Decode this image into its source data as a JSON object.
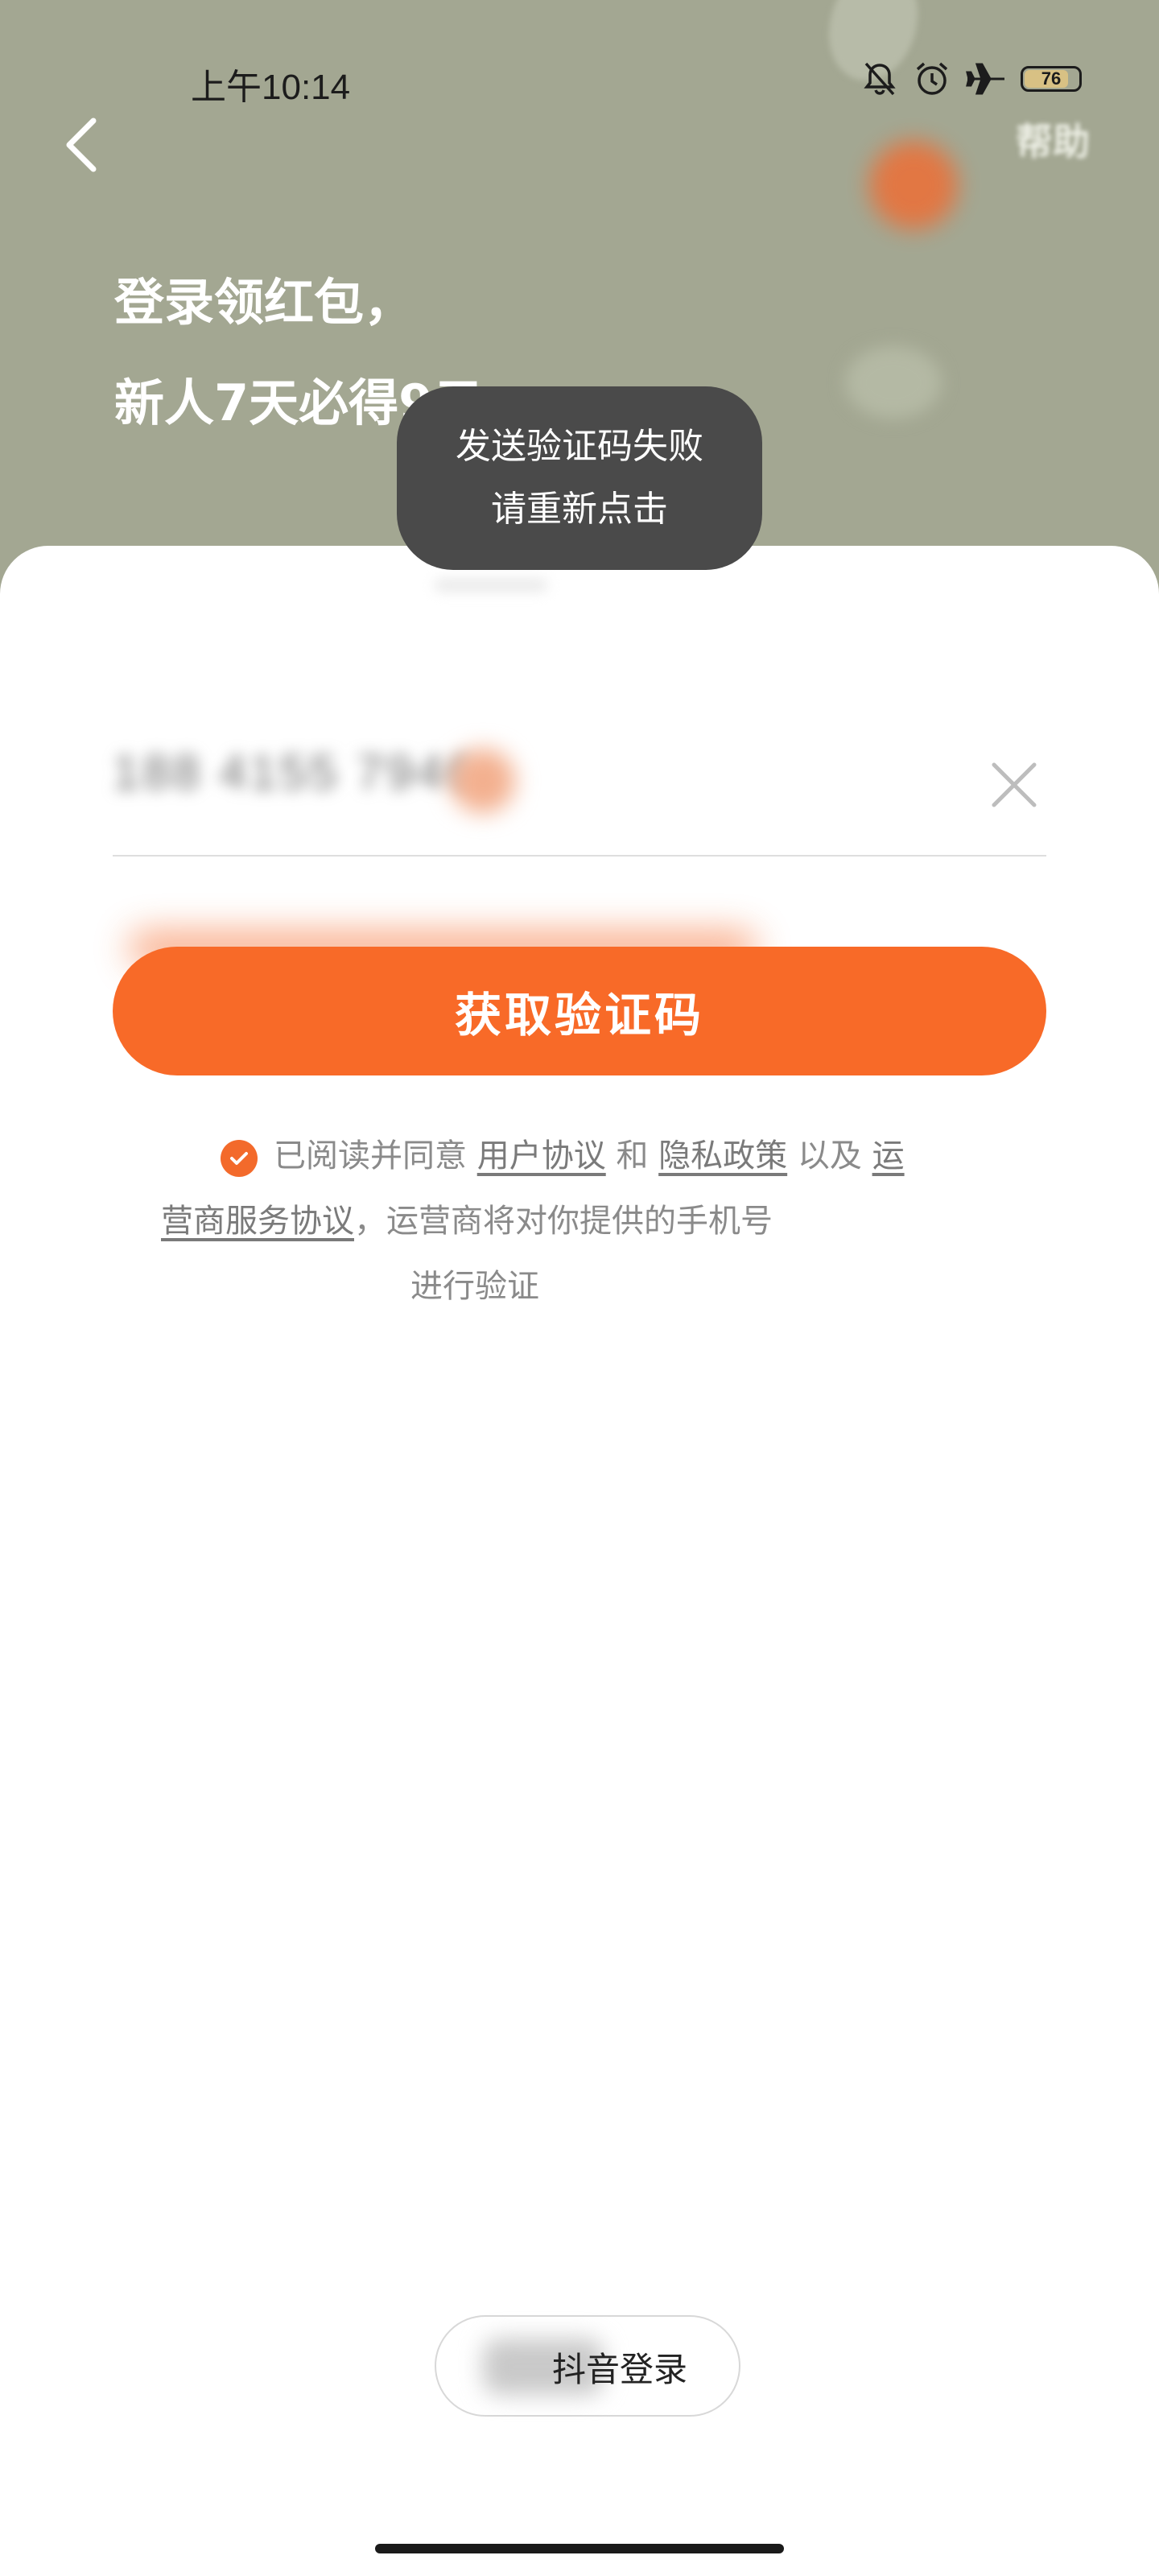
{
  "status_bar": {
    "time": "上午10:14",
    "battery": "76"
  },
  "header": {
    "help": "帮助",
    "title_line1": "登录领红包，",
    "title_line2": "新人7天必得9元"
  },
  "toast": {
    "line1": "发送验证码失败",
    "line2": "请重新点击"
  },
  "form": {
    "phone_value": "188 4155 7946",
    "get_code_label": "获取验证码"
  },
  "agreement": {
    "prefix": "已阅读并同意",
    "user_agreement": "用户协议",
    "and": "和",
    "privacy_policy": "隐私政策",
    "also": "以及",
    "carrier_agreement_part1": "运",
    "carrier_agreement_part2": "营商服务协议",
    "suffix": "，运营商将对你提供的手机号",
    "suffix2": "进行验证"
  },
  "alt_login": {
    "label": "抖音登录"
  },
  "colors": {
    "accent": "#f86a28",
    "header_bg": "#a3a792"
  }
}
